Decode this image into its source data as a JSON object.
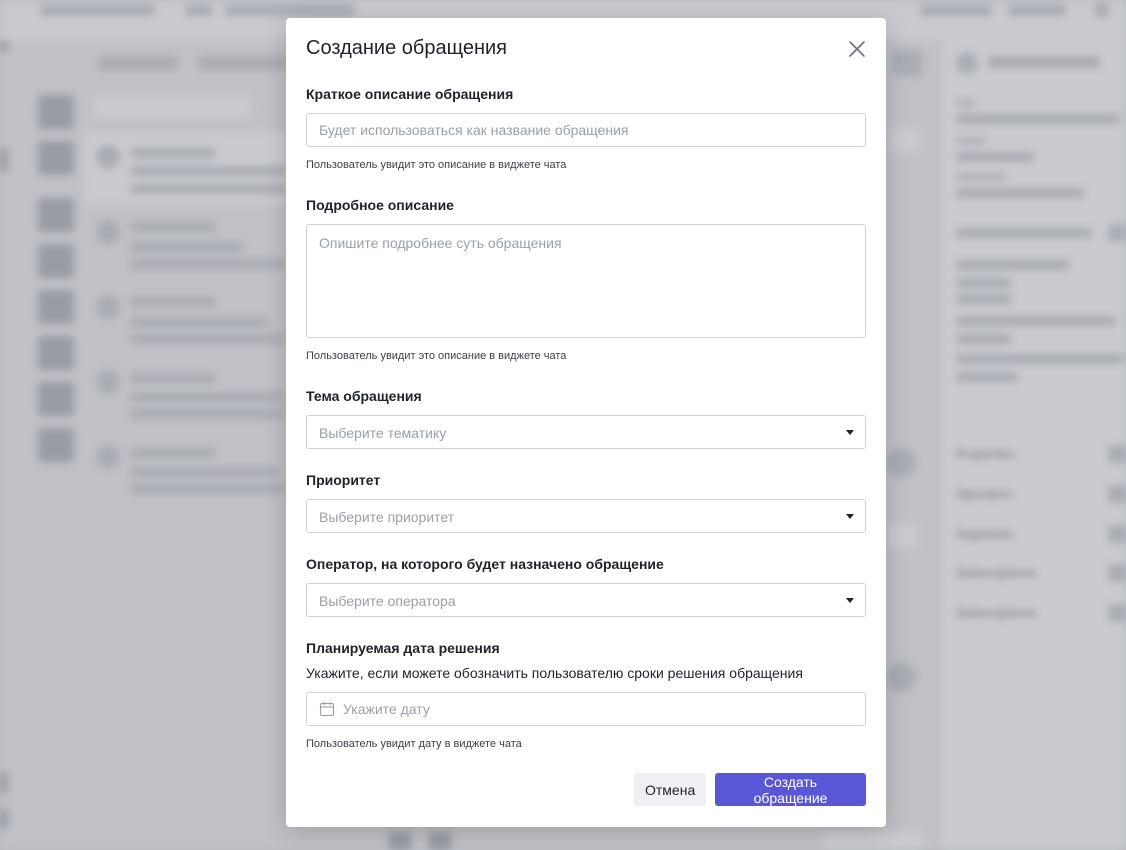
{
  "modal": {
    "title": "Создание обращения",
    "short_description": {
      "label": "Краткое описание обращения",
      "placeholder": "Будет использоваться как название обращения",
      "hint": "Пользователь увидит это описание в виджете чата"
    },
    "full_description": {
      "label": "Подробное описание",
      "placeholder": "Опишите подробнее суть обращения",
      "hint": "Пользователь увидит это описание в виджете чата"
    },
    "topic": {
      "label": "Тема обращения",
      "placeholder": "Выберите тематику"
    },
    "priority": {
      "label": "Приоритет",
      "placeholder": "Выберите приоритет"
    },
    "operator": {
      "label": "Оператор, на которого будет назначено обращение",
      "placeholder": "Выберите оператора"
    },
    "due_date": {
      "label": "Планируемая дата решения",
      "sublabel": "Укажите, если можете обозначить пользователю сроки решения обращения",
      "placeholder": "Укажите дату",
      "hint": "Пользователь увидит дату в виджете чата"
    },
    "buttons": {
      "cancel": "Отмена",
      "submit": "Создать обращение"
    }
  },
  "background_sidebar": {
    "items": [
      "Properties",
      "Operators",
      "Segments",
      "Subscriptions",
      "Subscriptions"
    ]
  },
  "colors": {
    "primary": "#5a57d6",
    "field_border": "#cfd3d9",
    "placeholder": "#9aa0a8",
    "cancel_bg": "#eef0f3"
  }
}
